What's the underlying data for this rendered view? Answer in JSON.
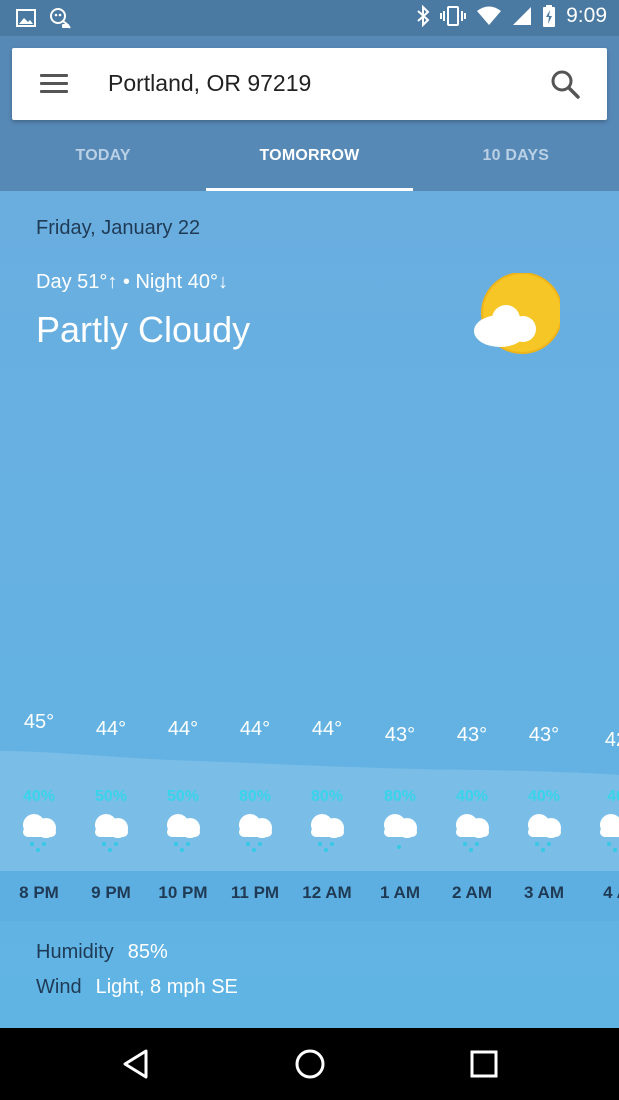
{
  "status_bar": {
    "time": "9:09",
    "left_icons": [
      "image-icon",
      "assistant-icon"
    ],
    "right_icons": [
      "bluetooth-icon",
      "vibrate-icon",
      "wifi-icon",
      "signal-icon",
      "battery-icon"
    ]
  },
  "search": {
    "location": "Portland, OR 97219"
  },
  "tabs": [
    {
      "label": "TODAY",
      "active": false
    },
    {
      "label": "TOMORROW",
      "active": true
    },
    {
      "label": "10 DAYS",
      "active": false
    }
  ],
  "forecast": {
    "date": "Friday, January 22",
    "day_night": "Day 51°↑ • Night 40°↓",
    "condition": "Partly Cloudy",
    "icon": "partly-cloudy-icon"
  },
  "hourly": [
    {
      "temp": "45°",
      "precip": "40%",
      "time": "8 PM",
      "icon": "rain-cloud-icon"
    },
    {
      "temp": "44°",
      "precip": "50%",
      "time": "9 PM",
      "icon": "rain-cloud-icon"
    },
    {
      "temp": "44°",
      "precip": "50%",
      "time": "10 PM",
      "icon": "rain-cloud-icon"
    },
    {
      "temp": "44°",
      "precip": "80%",
      "time": "11 PM",
      "icon": "rain-cloud-icon"
    },
    {
      "temp": "44°",
      "precip": "80%",
      "time": "12 AM",
      "icon": "rain-cloud-icon"
    },
    {
      "temp": "43°",
      "precip": "80%",
      "time": "1 AM",
      "icon": "light-rain-cloud-icon"
    },
    {
      "temp": "43°",
      "precip": "40%",
      "time": "2 AM",
      "icon": "rain-cloud-icon"
    },
    {
      "temp": "43°",
      "precip": "40%",
      "time": "3 AM",
      "icon": "rain-cloud-icon"
    },
    {
      "temp": "42",
      "precip": "40",
      "time": "4 A",
      "icon": "rain-cloud-icon"
    }
  ],
  "details": {
    "humidity_label": "Humidity",
    "humidity_value": "85%",
    "wind_label": "Wind",
    "wind_value": "Light, 8 mph SE"
  },
  "colors": {
    "header": "#5789b7",
    "status_bar": "#4a79a1",
    "content": "#63b1df",
    "precip": "#39d3ea",
    "dark_text": "#1f3a55"
  }
}
